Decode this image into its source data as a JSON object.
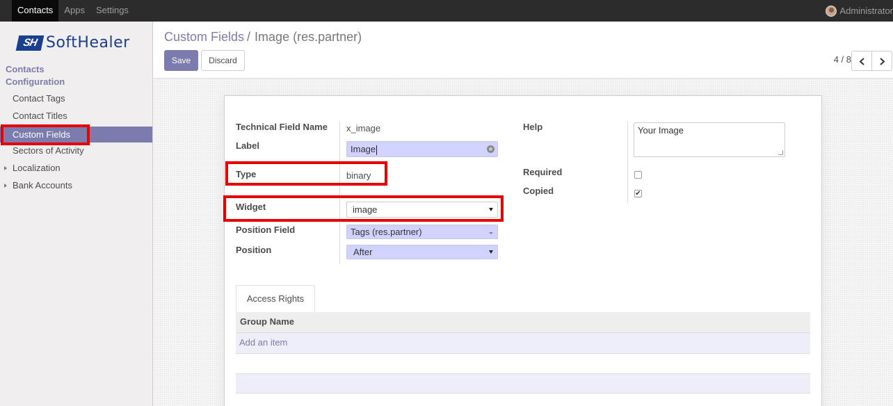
{
  "topbar": {
    "nav": [
      "Contacts",
      "Apps",
      "Settings"
    ],
    "active_nav": "Contacts",
    "user": "Administrator"
  },
  "logo": {
    "mark": "SH",
    "text": "SoftHealer"
  },
  "sidebar": {
    "section_title": "Contacts",
    "config_title": "Configuration",
    "items": [
      {
        "label": "Contact Tags"
      },
      {
        "label": "Contact Titles"
      },
      {
        "label": "Custom Fields"
      },
      {
        "label": "Sectors of Activity"
      },
      {
        "label": "Localization"
      },
      {
        "label": "Bank Accounts"
      }
    ],
    "active_item": "Custom Fields"
  },
  "breadcrumb": {
    "parent": "Custom Fields",
    "separator": "/",
    "current": "Image (res.partner)"
  },
  "toolbar": {
    "save_label": "Save",
    "discard_label": "Discard"
  },
  "pager": {
    "text": "4 / 8"
  },
  "form": {
    "technical_field_name": {
      "label": "Technical Field Name",
      "value": "x_image"
    },
    "field_label": {
      "label": "Label",
      "value": "Image"
    },
    "type": {
      "label": "Type",
      "value": "binary"
    },
    "widget": {
      "label": "Widget",
      "value": "image"
    },
    "position_field": {
      "label": "Position Field",
      "value": "Tags (res.partner)"
    },
    "position": {
      "label": "Position",
      "value": "After"
    },
    "help": {
      "label": "Help",
      "value": "Your Image"
    },
    "required": {
      "label": "Required",
      "checked": false
    },
    "copied": {
      "label": "Copied",
      "checked": true,
      "mark": "✔"
    }
  },
  "tabs": {
    "access_rights": "Access Rights"
  },
  "table": {
    "header": "Group Name",
    "add_item": "Add an item"
  },
  "colors": {
    "accent": "#7c7bad",
    "highlight": "#e60000",
    "topbar": "#2c2c2c"
  }
}
